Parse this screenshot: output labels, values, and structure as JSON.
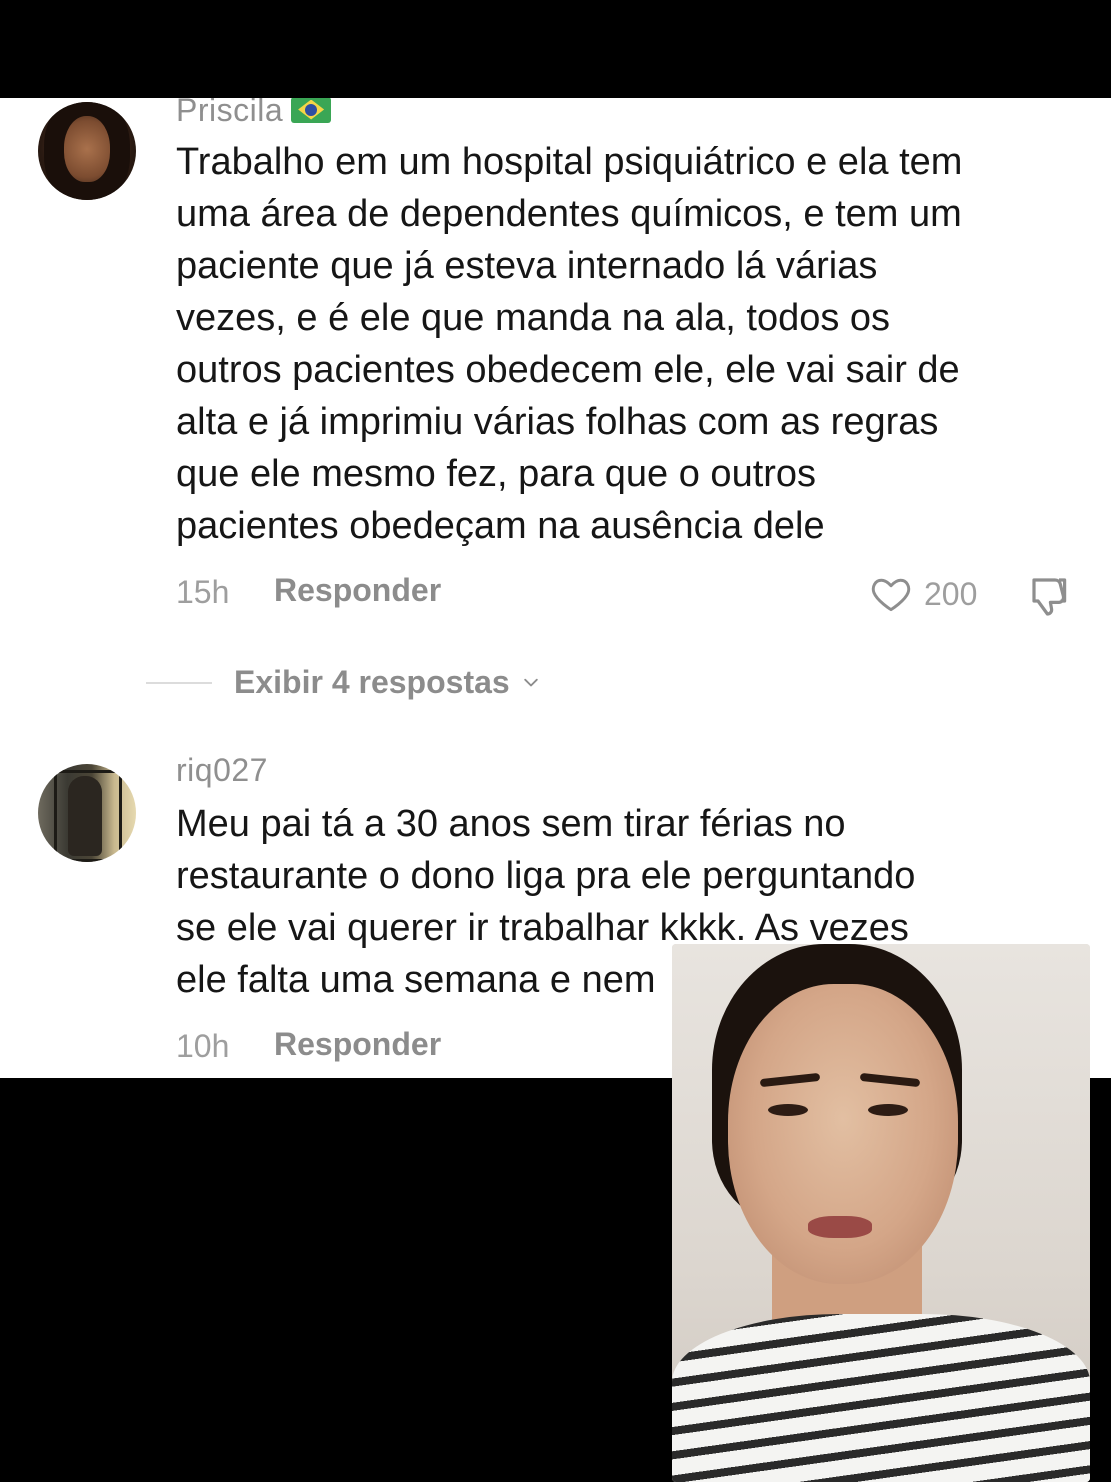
{
  "comments": [
    {
      "username": "Priscila",
      "flag_icon": "brazil-flag-icon",
      "text": "Trabalho em um hospital psiquiátrico e ela tem\numa área de dependentes químicos, e tem um\npaciente que já esteva internado lá várias\nvezes, e é ele que manda na ala, todos os\noutros pacientes obedecem ele, ele vai sair de\nalta e já imprimiu várias folhas com as regras\nque ele mesmo fez, para que o outros\npacientes obedeçam na ausência dele",
      "time": "15h",
      "reply_label": "Responder",
      "like_count": "200",
      "replies_toggle_label": "Exibir 4 respostas"
    },
    {
      "username": "riq027",
      "text": "Meu pai tá a 30 anos sem tirar férias no\nrestaurante o dono liga pra ele perguntando\nse ele vai querer ir trabalhar kkkk. As vezes\nele falta uma semana e nem",
      "time": "10h",
      "reply_label": "Responder"
    }
  ],
  "icons": {
    "like": "heart-outline-icon",
    "dislike": "thumbs-down-icon",
    "chevron": "chevron-down-icon"
  },
  "colors": {
    "panel_background": "#ffffff",
    "frame_background": "#000000",
    "body_text": "#161616",
    "muted_text": "#8c8c8c"
  }
}
